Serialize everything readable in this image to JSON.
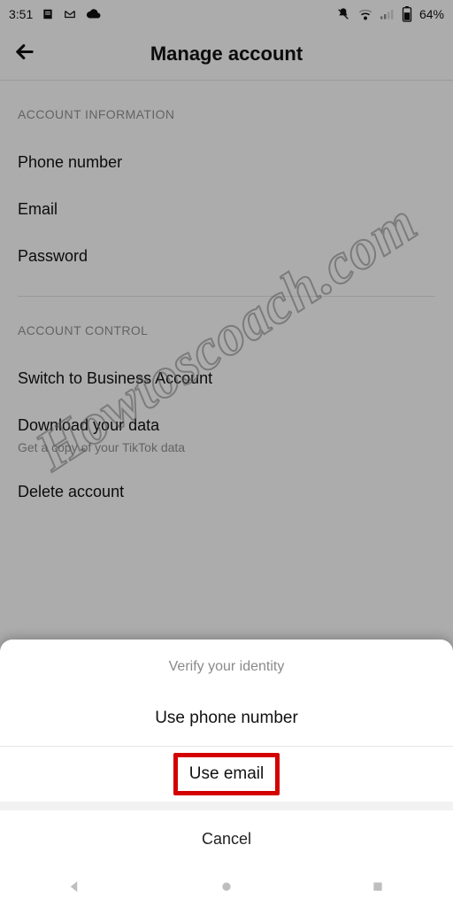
{
  "status": {
    "time": "3:51",
    "battery": "64%"
  },
  "header": {
    "title": "Manage account"
  },
  "sections": {
    "info": {
      "header": "ACCOUNT INFORMATION",
      "rows": {
        "phone": "Phone number",
        "email": "Email",
        "password": "Password"
      }
    },
    "control": {
      "header": "ACCOUNT CONTROL",
      "rows": {
        "switch": "Switch to Business Account",
        "download": "Download your data",
        "download_sub": "Get a copy of your TikTok data",
        "delete": "Delete account"
      }
    }
  },
  "watermark": "Howtoscoach.com",
  "sheet": {
    "title": "Verify your identity",
    "option_phone": "Use phone number",
    "option_email": "Use email",
    "cancel": "Cancel"
  }
}
